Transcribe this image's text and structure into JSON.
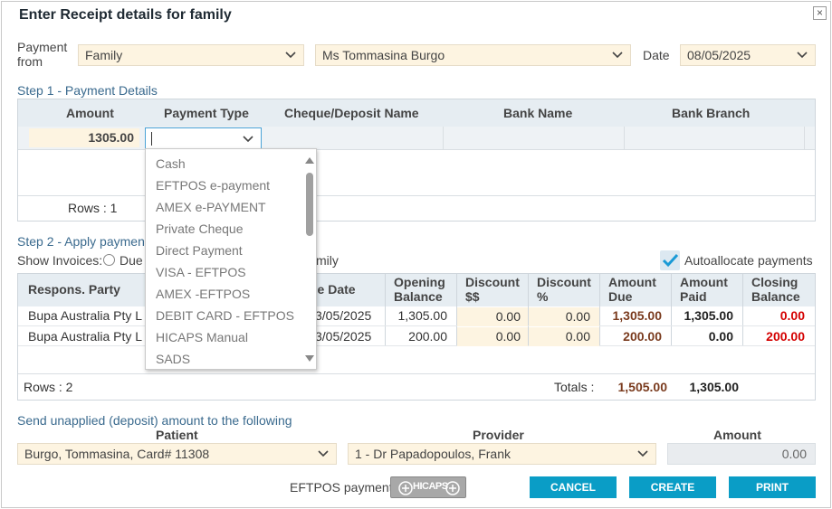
{
  "dialog": {
    "title": "Enter Receipt details for family",
    "close": "×"
  },
  "payment_from": {
    "label": "Payment from",
    "source": "Family",
    "person": "Ms Tommasina  Burgo",
    "date_label": "Date",
    "date": "08/05/2025"
  },
  "step1": {
    "title": "Step 1 - Payment Details",
    "columns": [
      "Amount",
      "Payment Type",
      "Cheque/Deposit Name",
      "Bank Name",
      "Bank Branch"
    ],
    "amount": "1305.00",
    "payment_type_value": "",
    "rows_label": "Rows : 1"
  },
  "dropdown": {
    "options": [
      "Cash",
      "EFTPOS e-payment",
      "AMEX e-PAYMENT",
      "Private Cheque",
      "Direct Payment",
      "VISA - EFTPOS",
      "AMEX -EFTPOS",
      "DEBIT CARD - EFTPOS",
      "HICAPS Manual",
      "SADS"
    ]
  },
  "step2": {
    "title": "Step 2 - Apply payment",
    "show_invoices_label": "Show Invoices:",
    "radio_due": "Due",
    "radio_family_tail": "mily",
    "autoallocate_label": "Autoallocate payments",
    "autoallocate_checked": true,
    "columns": {
      "respons": "Respons. Party",
      "due_date": "ue Date",
      "opening_balance": "Opening Balance",
      "discount_amt": "Discount $$",
      "discount_pct": "Discount %",
      "amount_due": "Amount Due",
      "amount_paid": "Amount Paid",
      "closing_balance": "Closing Balance"
    },
    "rows": [
      {
        "party": "Bupa Australia Pty L",
        "due_date": "3/05/2025",
        "opening": "1,305.00",
        "disc_amt": "0.00",
        "disc_pct": "0.00",
        "due": "1,305.00",
        "paid": "1,305.00",
        "closing": "0.00"
      },
      {
        "party": "Bupa Australia Pty L",
        "due_date": "3/05/2025",
        "opening": "200.00",
        "disc_amt": "0.00",
        "disc_pct": "0.00",
        "due": "200.00",
        "paid": "0.00",
        "closing": "200.00"
      }
    ],
    "rows_label": "Rows : 2",
    "totals_label": "Totals :",
    "total_due": "1,505.00",
    "total_paid": "1,305.00"
  },
  "deposit": {
    "title": "Send unapplied (deposit) amount to the following",
    "patient_label": "Patient",
    "patient_value": "Burgo, Tommasina, Card# 11308",
    "provider_label": "Provider",
    "provider_value": "1 - Dr Papadopoulos, Frank",
    "amount_label": "Amount",
    "amount_value": "0.00"
  },
  "footer": {
    "eftpos_label": "EFTPOS payment",
    "hicaps_logo": "HICAPS",
    "cancel": "CANCEL",
    "create": "CREATE",
    "print": "PRINT"
  },
  "colors": {
    "accent": "#0a9dc6",
    "field_bg": "#fdf4e1",
    "header_bg": "#e6edf2",
    "negative_red": "#d40000",
    "due_brown": "#7a3b1e"
  }
}
